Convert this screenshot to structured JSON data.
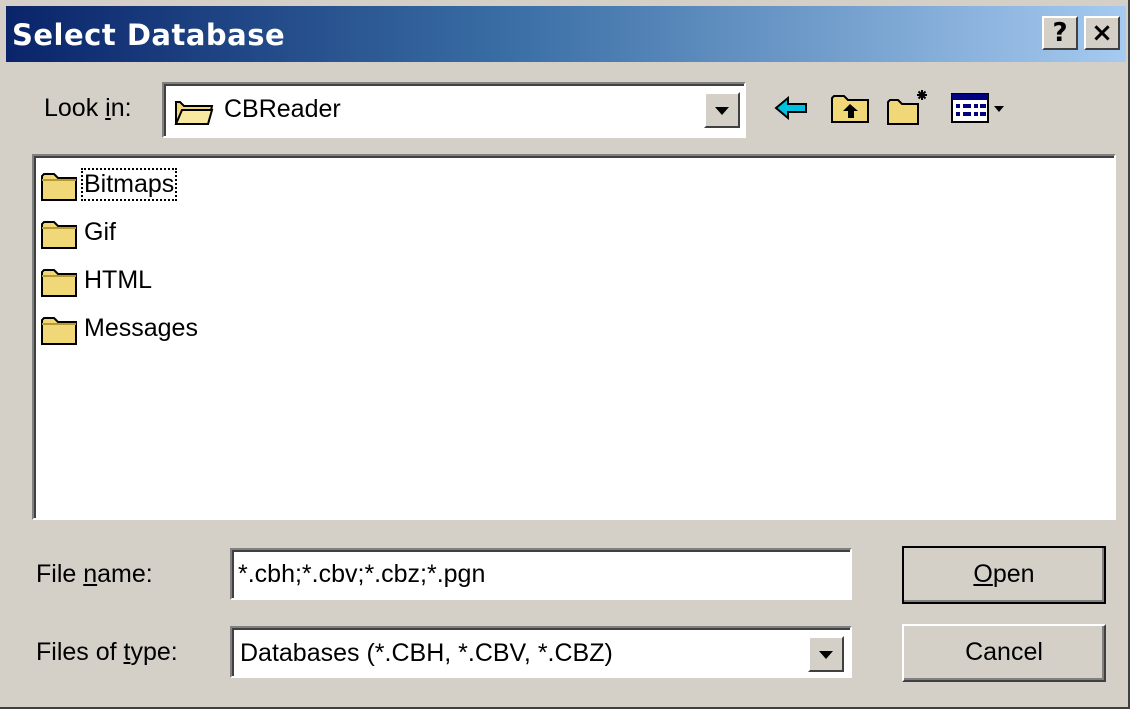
{
  "window": {
    "title": "Select Database",
    "help_glyph": "?",
    "close_glyph": "×"
  },
  "look_in": {
    "label_pre": "Look ",
    "label_accel": "i",
    "label_post": "n:",
    "value": "CBReader"
  },
  "toolbar": {
    "back_icon": "back-arrow-icon",
    "up_icon": "up-folder-icon",
    "new_folder_icon": "new-folder-icon",
    "view_menu_icon": "view-menu-icon"
  },
  "files": [
    {
      "name": "Bitmaps",
      "type": "folder",
      "focused": true
    },
    {
      "name": "Gif",
      "type": "folder",
      "focused": false
    },
    {
      "name": "HTML",
      "type": "folder",
      "focused": false
    },
    {
      "name": "Messages",
      "type": "folder",
      "focused": false
    }
  ],
  "file_name": {
    "label_pre": "File ",
    "label_accel": "n",
    "label_post": "ame:",
    "value": "*.cbh;*.cbv;*.cbz;*.pgn"
  },
  "file_type": {
    "label_pre": "Files of ",
    "label_accel": "t",
    "label_post": "ype:",
    "value": "Databases (*.CBH, *.CBV, *.CBZ)"
  },
  "buttons": {
    "open_accel": "O",
    "open_rest": "pen",
    "cancel": "Cancel"
  },
  "colors": {
    "title_start": "#0a246a",
    "title_end": "#a6caf0",
    "face": "#d4d0c8",
    "folder": "#f0d878"
  }
}
